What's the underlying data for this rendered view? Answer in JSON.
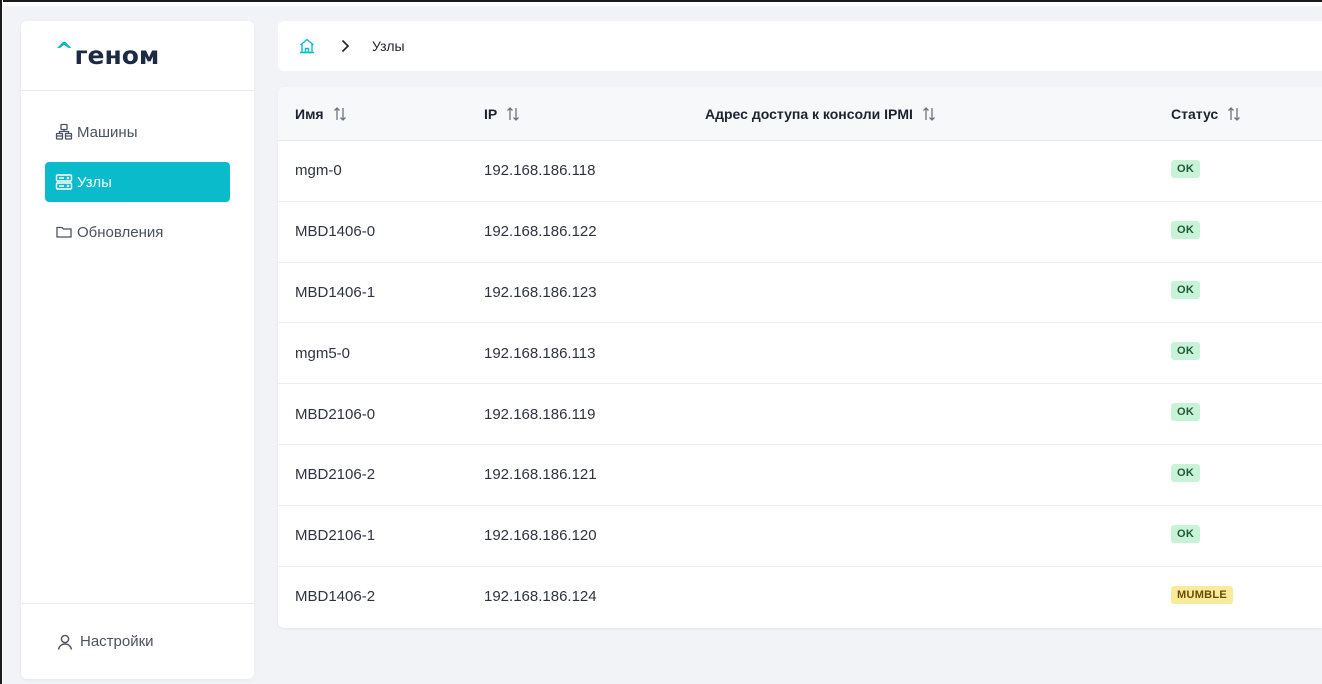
{
  "brand": {
    "caret": "^",
    "name": "геном"
  },
  "sidebar": {
    "items": [
      {
        "label": "Машины",
        "icon": "machines-icon",
        "active": false
      },
      {
        "label": "Узлы",
        "icon": "server-icon",
        "active": true
      },
      {
        "label": "Обновления",
        "icon": "folder-icon",
        "active": false
      }
    ],
    "settings_label": "Настройки",
    "accent_color": "#0abccb"
  },
  "breadcrumb": {
    "home_icon": "home-icon",
    "separator_icon": "chevron-right-icon",
    "current": "Узлы"
  },
  "table": {
    "columns": [
      "Имя",
      "IP",
      "Адрес доступа к консоли IPMI",
      "Статус"
    ],
    "rows": [
      {
        "name": "mgm-0",
        "ip": "192.168.186.118",
        "ipmi": "",
        "status": "OK"
      },
      {
        "name": "MBD1406-0",
        "ip": "192.168.186.122",
        "ipmi": "",
        "status": "OK"
      },
      {
        "name": "MBD1406-1",
        "ip": "192.168.186.123",
        "ipmi": "",
        "status": "OK"
      },
      {
        "name": "mgm5-0",
        "ip": "192.168.186.113",
        "ipmi": "",
        "status": "OK"
      },
      {
        "name": "MBD2106-0",
        "ip": "192.168.186.119",
        "ipmi": "",
        "status": "OK"
      },
      {
        "name": "MBD2106-2",
        "ip": "192.168.186.121",
        "ipmi": "",
        "status": "OK"
      },
      {
        "name": "MBD2106-1",
        "ip": "192.168.186.120",
        "ipmi": "",
        "status": "OK"
      },
      {
        "name": "MBD1406-2",
        "ip": "192.168.186.124",
        "ipmi": "",
        "status": "MUMBLE"
      }
    ]
  },
  "status_colors": {
    "OK": "#c9f3d9",
    "MUMBLE": "#faeb9a"
  }
}
